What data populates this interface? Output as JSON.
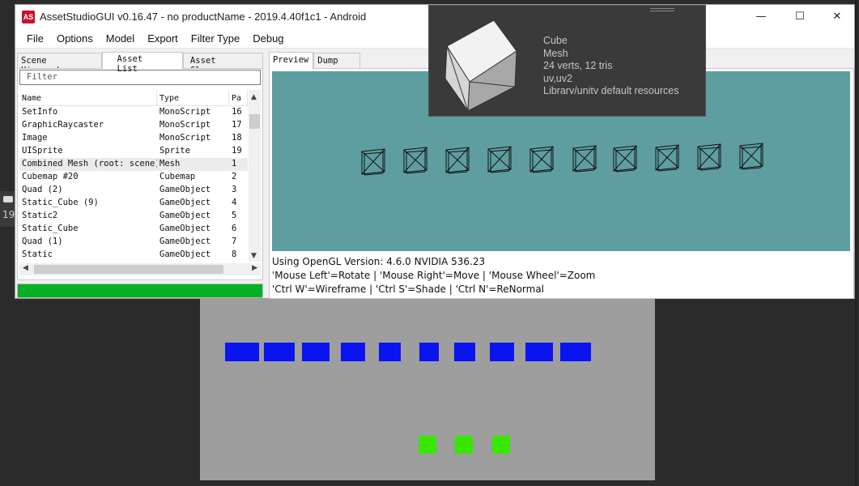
{
  "window": {
    "title": "AssetStudioGUI v0.16.47 - no productName - 2019.4.40f1c1 - Android",
    "icon_text": "AS",
    "minimize": "—",
    "maximize": "☐",
    "close": "✕"
  },
  "menu": [
    "File",
    "Options",
    "Model",
    "Export",
    "Filter Type",
    "Debug"
  ],
  "left_tabs": [
    "Scene Hierarchy",
    "Asset List",
    "Asset Classes"
  ],
  "filter_placeholder": "Filter",
  "columns": [
    "Name",
    "Type",
    "Pa"
  ],
  "rows": [
    {
      "name": "SetInfo",
      "type": "MonoScript",
      "path": "16"
    },
    {
      "name": "GraphicRaycaster",
      "type": "MonoScript",
      "path": "17"
    },
    {
      "name": "Image",
      "type": "MonoScript",
      "path": "18"
    },
    {
      "name": "UISprite",
      "type": "Sprite",
      "path": "19"
    },
    {
      "name": "Combined Mesh (root: scene)",
      "type": "Mesh",
      "path": "1"
    },
    {
      "name": "Cubemap #20",
      "type": "Cubemap",
      "path": "2"
    },
    {
      "name": "Quad (2)",
      "type": "GameObject",
      "path": "3"
    },
    {
      "name": "Static_Cube (9)",
      "type": "GameObject",
      "path": "4"
    },
    {
      "name": "Static2",
      "type": "GameObject",
      "path": "5"
    },
    {
      "name": "Static_Cube",
      "type": "GameObject",
      "path": "6"
    },
    {
      "name": "Quad (1)",
      "type": "GameObject",
      "path": "7"
    },
    {
      "name": "Static",
      "type": "GameObject",
      "path": "8"
    }
  ],
  "selected_row": 4,
  "progress": 1.0,
  "right_tabs": [
    "Preview",
    "Dump"
  ],
  "preview_info": [
    "Using OpenGL Version: 4.6.0 NVIDIA 536.23",
    "'Mouse Left'=Rotate | 'Mouse Right'=Move | 'Mouse Wheel'=Zoom",
    "'Ctrl W'=Wireframe | 'Ctrl S'=Shade | 'Ctrl N'=ReNormal"
  ],
  "tooltip": {
    "name": "Cube",
    "type": "Mesh",
    "stats": "24 verts, 12 tris",
    "uv": "uv,uv2",
    "source": "Librarv/unitv default resources"
  },
  "left_strip_number": "19",
  "colors": {
    "accent_green": "#06b025",
    "preview_bg": "#5e9ea0",
    "blue_squares": "#0a14f0",
    "green_squares": "#38e802"
  }
}
